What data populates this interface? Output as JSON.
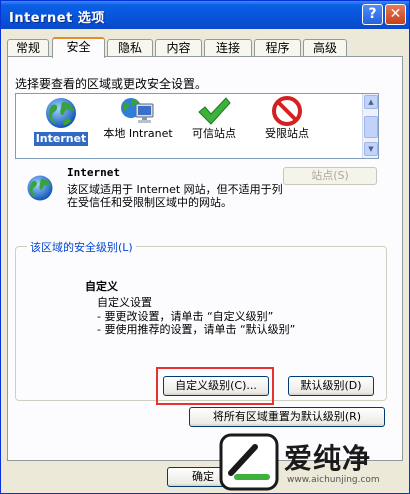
{
  "window": {
    "title": "Internet 选项",
    "help": "?",
    "close": "✕"
  },
  "tabs": [
    {
      "label": "常规"
    },
    {
      "label": "安全"
    },
    {
      "label": "隐私"
    },
    {
      "label": "内容"
    },
    {
      "label": "连接"
    },
    {
      "label": "程序"
    },
    {
      "label": "高级"
    }
  ],
  "security": {
    "prompt": "选择要查看的区域或更改安全设置。",
    "zones": [
      {
        "label": "Internet",
        "icon": "globe-icon"
      },
      {
        "label": "本地 Intranet",
        "icon": "intranet-icon"
      },
      {
        "label": "可信站点",
        "icon": "checkmark-icon"
      },
      {
        "label": "受限站点",
        "icon": "restricted-icon"
      }
    ],
    "selected_zone": "Internet",
    "zone_desc": "该区域适用于 Internet 网站，但不适用于列在受信任和受限制区域中的网站。",
    "sites_button": "站点(S)",
    "group_label": "该区域的安全级别(L)",
    "level_title": "自定义",
    "level_sub": "自定义设置",
    "level_lines": [
      "- 要更改设置，请单击 “自定义级别”",
      "- 要使用推荐的设置，请单击 “默认级别”"
    ],
    "custom_level_button": "自定义级别(C)...",
    "default_level_button": "默认级别(D)",
    "reset_all_button": "将所有区域重置为默认级别(R)"
  },
  "footer": {
    "ok_button": "确定"
  },
  "watermark": {
    "text": "爱纯净",
    "url": "www.aichunjing.com"
  },
  "colors": {
    "title_bar": "#0853d9",
    "selection": "#316ac5",
    "highlight": "#e8322f"
  }
}
